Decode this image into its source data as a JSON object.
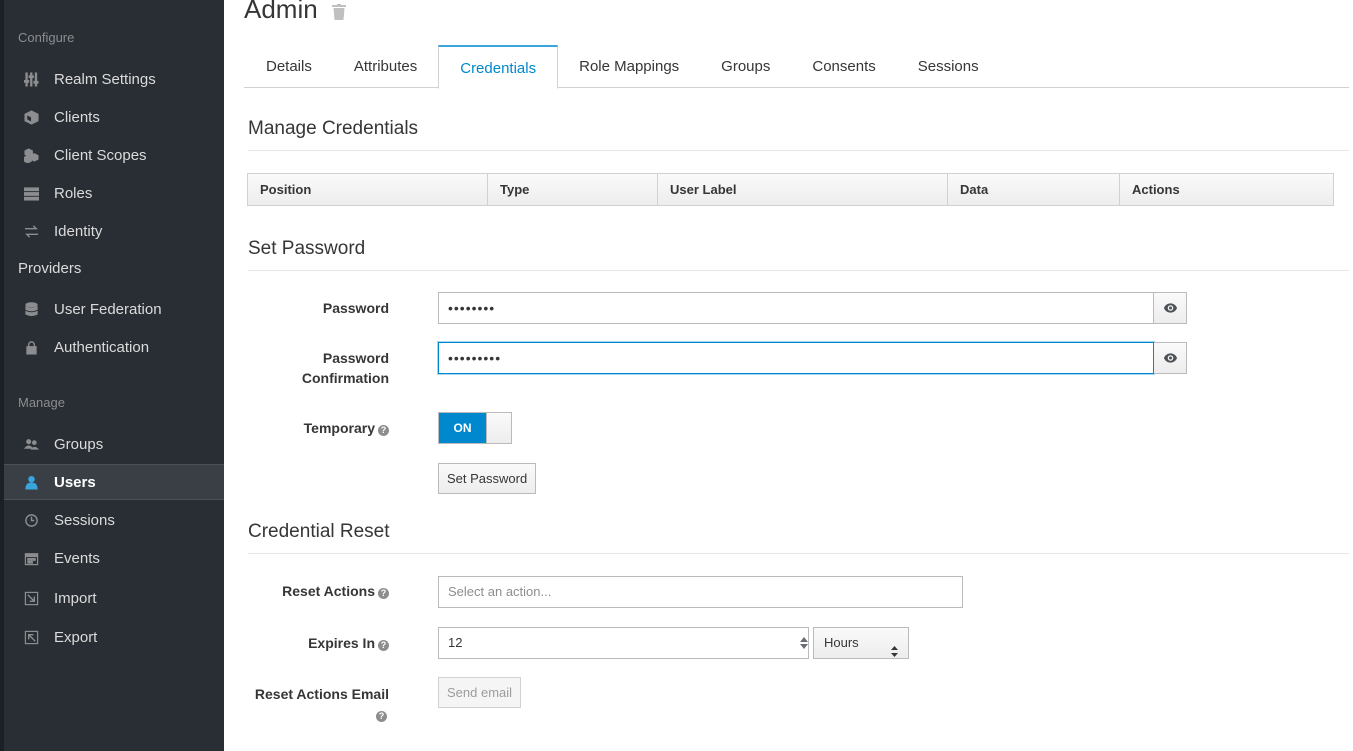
{
  "sidebar": {
    "sections": {
      "configure": "Configure",
      "manage": "Manage"
    },
    "configure_items": [
      {
        "label": "Realm Settings",
        "icon": "sliders-icon"
      },
      {
        "label": "Clients",
        "icon": "cube-icon"
      },
      {
        "label": "Client Scopes",
        "icon": "cubes-icon"
      },
      {
        "label": "Roles",
        "icon": "roles-list-icon"
      },
      {
        "label": "Identity",
        "label2": "Providers",
        "icon": "exchange-icon"
      },
      {
        "label": "User Federation",
        "icon": "database-icon"
      },
      {
        "label": "Authentication",
        "icon": "lock-icon"
      }
    ],
    "manage_items": [
      {
        "label": "Groups",
        "icon": "users-icon"
      },
      {
        "label": "Users",
        "icon": "user-icon",
        "active": true
      },
      {
        "label": "Sessions",
        "icon": "clock-icon"
      },
      {
        "label": "Events",
        "icon": "calendar-icon"
      },
      {
        "label": "Import",
        "icon": "import-icon"
      },
      {
        "label": "Export",
        "icon": "export-icon"
      }
    ]
  },
  "header": {
    "title": "Admin",
    "trash_icon": "trash-icon"
  },
  "tabs": [
    {
      "label": "Details"
    },
    {
      "label": "Attributes"
    },
    {
      "label": "Credentials",
      "active": true
    },
    {
      "label": "Role Mappings"
    },
    {
      "label": "Groups"
    },
    {
      "label": "Consents"
    },
    {
      "label": "Sessions"
    }
  ],
  "manage_credentials": {
    "title": "Manage Credentials",
    "columns": [
      "Position",
      "Type",
      "User Label",
      "Data",
      "Actions"
    ]
  },
  "set_password": {
    "title": "Set Password",
    "password_label": "Password",
    "password_value": "••••••••",
    "confirm_label_line1": "Password",
    "confirm_label_line2": "Confirmation",
    "confirm_value": "•••••••••",
    "temporary_label": "Temporary",
    "temporary_state": "ON",
    "submit_label": "Set Password"
  },
  "credential_reset": {
    "title": "Credential Reset",
    "reset_actions_label": "Reset Actions",
    "reset_actions_placeholder": "Select an action...",
    "expires_label": "Expires In",
    "expires_value": "12",
    "expires_unit": "Hours",
    "email_label": "Reset Actions Email",
    "send_email_label": "Send email"
  },
  "colors": {
    "sidebar_bg": "#292e34",
    "accent": "#0088ce",
    "active_icon": "#39a5dc"
  }
}
